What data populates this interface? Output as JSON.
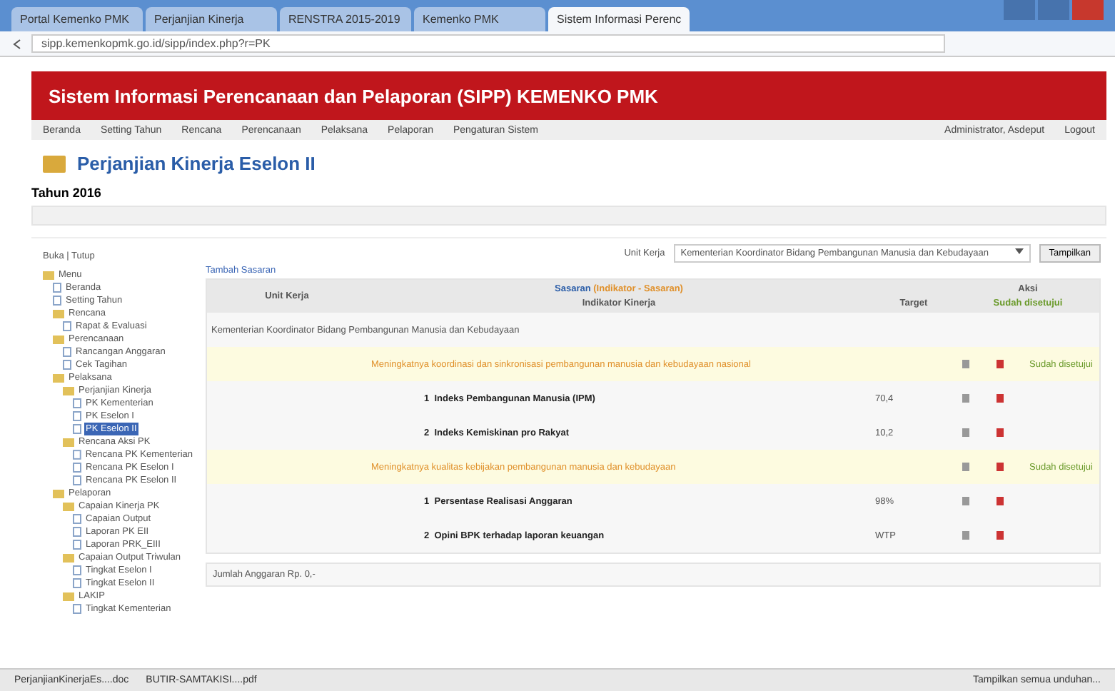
{
  "browser": {
    "tabs": [
      {
        "label": "Portal Kemenko PMK",
        "selected": false
      },
      {
        "label": "Perjanjian Kinerja",
        "selected": false
      },
      {
        "label": "RENSTRA 2015-2019",
        "selected": false
      },
      {
        "label": "Kemenko PMK",
        "selected": false
      },
      {
        "label": "Sistem Informasi Perenc",
        "selected": true
      }
    ],
    "address": "sipp.kemenkopmk.go.id/sipp/index.php?r=PK"
  },
  "header": {
    "title": "Sistem Informasi Perencanaan dan Pelaporan (SIPP) KEMENKO PMK"
  },
  "menu": {
    "items": [
      "Beranda",
      "Setting Tahun",
      "Rencana",
      "Perencanaan",
      "Pelaksana",
      "Pelaporan",
      "Pengaturan Sistem"
    ],
    "user": "Administrator, Asdeput",
    "logout": "Logout"
  },
  "page": {
    "title": "Perjanjian Kinerja Eselon II",
    "year": "Tahun 2016"
  },
  "tree": {
    "toggle": "Buka | Tutup",
    "items": [
      {
        "label": "Menu",
        "children": [
          {
            "label": "Beranda"
          },
          {
            "label": "Setting Tahun"
          },
          {
            "label": "Rencana",
            "children": [
              {
                "label": "Rapat & Evaluasi"
              }
            ]
          },
          {
            "label": "Perencanaan",
            "children": [
              {
                "label": "Rancangan Anggaran"
              },
              {
                "label": "Cek Tagihan"
              }
            ]
          },
          {
            "label": "Pelaksana",
            "children": [
              {
                "label": "Perjanjian Kinerja",
                "children": [
                  {
                    "label": "PK Kementerian"
                  },
                  {
                    "label": "PK Eselon I"
                  },
                  {
                    "label": "PK Eselon II",
                    "selected": true
                  }
                ]
              },
              {
                "label": "Rencana Aksi PK",
                "children": [
                  {
                    "label": "Rencana PK Kementerian"
                  },
                  {
                    "label": "Rencana PK Eselon I"
                  },
                  {
                    "label": "Rencana PK Eselon II"
                  }
                ]
              }
            ]
          },
          {
            "label": "Pelaporan",
            "children": [
              {
                "label": "Capaian Kinerja PK",
                "children": [
                  {
                    "label": "Capaian Output"
                  },
                  {
                    "label": "Laporan PK EII"
                  },
                  {
                    "label": "Laporan PRK_EIII"
                  }
                ]
              },
              {
                "label": "Capaian Output Triwulan",
                "children": [
                  {
                    "label": "Tingkat Eselon I"
                  },
                  {
                    "label": "Tingkat Eselon II"
                  }
                ]
              },
              {
                "label": "LAKIP",
                "children": [
                  {
                    "label": "Tingkat Kementerian"
                  }
                ]
              }
            ]
          }
        ]
      }
    ]
  },
  "filter": {
    "label": "Unit Kerja",
    "value": "Kementerian Koordinator Bidang Pembangunan Manusia dan Kebudayaan",
    "button": "Tampilkan"
  },
  "table": {
    "add_link": "Tambah Sasaran",
    "columns": {
      "unit": "Unit Kerja",
      "sasaran": "Sasaran",
      "sasaran_note": "(Indikator - Sasaran)",
      "indikator": "Indikator Kinerja",
      "target": "Target",
      "aksi": "Aksi",
      "aksi_note": "Sudah disetujui"
    },
    "unit_name": "Kementerian Koordinator Bidang Pembangunan Manusia dan Kebudayaan",
    "rows": [
      {
        "kind": "sasaran",
        "text": "Meningkatnya koordinasi dan sinkronisasi pembangunan manusia dan kebudayaan nasional",
        "status": "Sudah disetujui"
      },
      {
        "kind": "indikator",
        "num": "1",
        "text": "Indeks Pembangunan Manusia (IPM)",
        "target": "70,4"
      },
      {
        "kind": "indikator",
        "num": "2",
        "text": "Indeks Kemiskinan pro Rakyat",
        "target": "10,2"
      },
      {
        "kind": "sasaran",
        "text": "Meningkatnya kualitas kebijakan pembangunan manusia dan kebudayaan",
        "status": "Sudah disetujui"
      },
      {
        "kind": "indikator",
        "num": "1",
        "text": "Persentase Realisasi Anggaran",
        "target": "98%"
      },
      {
        "kind": "indikator",
        "num": "2",
        "text": "Opini BPK terhadap laporan keuangan",
        "target": "WTP"
      }
    ],
    "footer": "Jumlah Anggaran Rp. 0,-"
  },
  "taskbar": {
    "downloads": [
      "PerjanjianKinerjaEs....doc",
      "BUTIR-SAMTAKISI....pdf"
    ],
    "show_all": "Tampilkan semua unduhan..."
  }
}
